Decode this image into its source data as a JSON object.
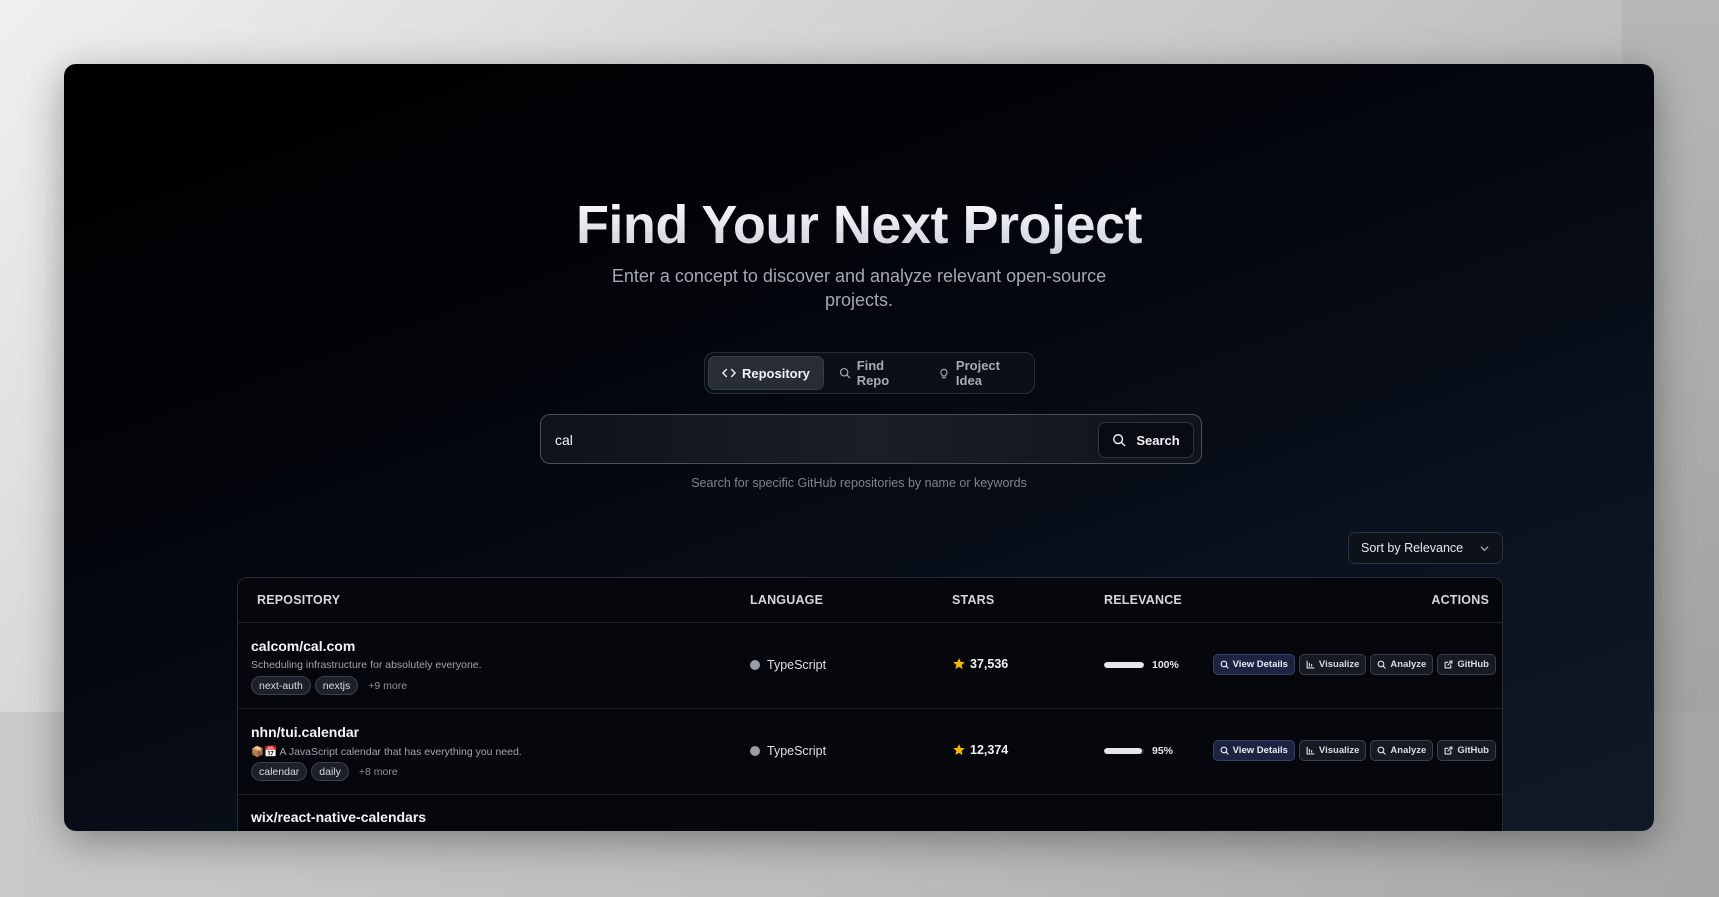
{
  "hero": {
    "title": "Find Your Next Project",
    "subtitle": "Enter a concept to discover and analyze relevant open-source projects."
  },
  "tabs": [
    {
      "label": "Repository",
      "icon": "code-icon",
      "active": true
    },
    {
      "label": "Find Repo",
      "icon": "search-icon",
      "active": false
    },
    {
      "label": "Project Idea",
      "icon": "lightbulb-icon",
      "active": false
    }
  ],
  "search": {
    "value": "cal",
    "button_label": "Search",
    "hint": "Search for specific GitHub repositories by name or keywords"
  },
  "sort": {
    "label": "Sort by Relevance"
  },
  "table": {
    "headers": {
      "repository": "REPOSITORY",
      "language": "LANGUAGE",
      "stars": "STARS",
      "relevance": "RELEVANCE",
      "actions": "ACTIONS"
    },
    "action_labels": {
      "view_details": "View Details",
      "visualize": "Visualize",
      "analyze": "Analyze",
      "github": "GitHub"
    },
    "rows": [
      {
        "name": "calcom/cal.com",
        "description": "Scheduling infrastructure for absolutely everyone.",
        "tags": [
          "next-auth",
          "nextjs"
        ],
        "more": "+9 more",
        "language": "TypeScript",
        "stars": "37,536",
        "relevance_label": "100%",
        "relevance": 100
      },
      {
        "name": "nhn/tui.calendar",
        "description": "📦📅 A JavaScript calendar that has everything you need.",
        "tags": [
          "calendar",
          "daily"
        ],
        "more": "+8 more",
        "language": "TypeScript",
        "stars": "12,374",
        "relevance_label": "95%",
        "relevance": 95
      },
      {
        "name": "wix/react-native-calendars"
      }
    ]
  },
  "colors": {
    "star": "#f5b800",
    "primary_action_bg": "#1d2340",
    "language_dot": "#9a9ea6"
  }
}
